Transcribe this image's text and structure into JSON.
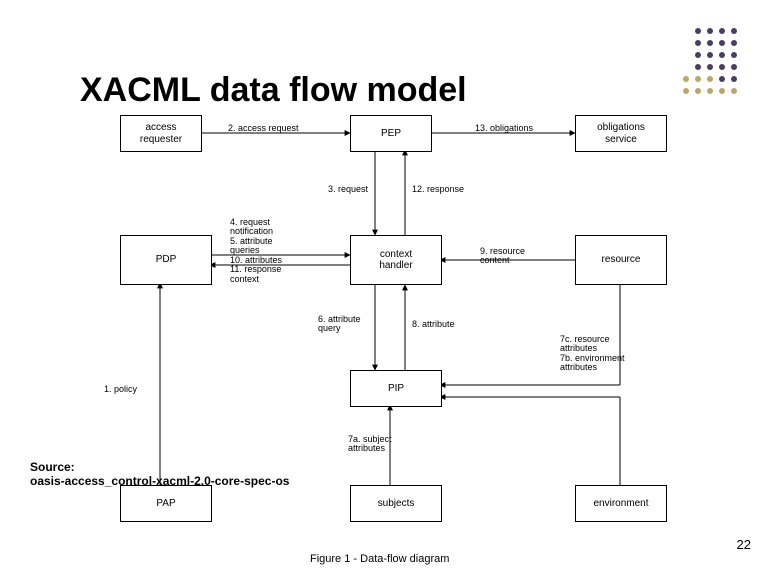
{
  "title": "XACML data flow model",
  "source_label": "Source:",
  "source_text": "oasis-access_control-xacml-2.0-core-spec-os",
  "page_number": "22",
  "caption": "Figure 1 - Data-flow diagram",
  "boxes": {
    "access_requester": "access\nrequester",
    "pep": "PEP",
    "obligations_service": "obligations\nservice",
    "pdp": "PDP",
    "context_handler": "context\nhandler",
    "resource": "resource",
    "pip": "PIP",
    "pap": "PAP",
    "subjects": "subjects",
    "environment": "environment"
  },
  "edge_labels": {
    "e2": "2. access request",
    "e13": "13. obligations",
    "e3": "3. request",
    "e12": "12. response",
    "e4_5_10_11": "4. request\nnotification\n5. attribute\nqueries\n10. attributes\n11. response\ncontext",
    "e9": "9. resource\ncontent",
    "e6": "6. attribute\nquery",
    "e8": "8. attribute",
    "e1": "1. policy",
    "e7c_7b": "7c. resource\nattributes\n7b. environment\nattributes",
    "e7a": "7a. subject\nattributes"
  }
}
